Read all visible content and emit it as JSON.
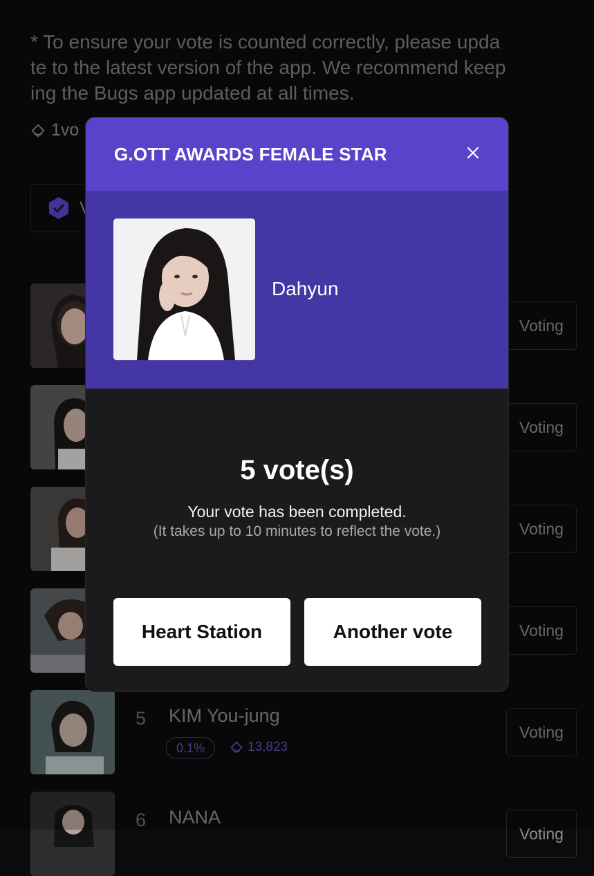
{
  "background": {
    "notice_top": "",
    "notice_lines": [
      "* To ensure your vote is counted correctly, please upda",
      "te to the latest version of the app. We recommend keep",
      "ing the Bugs app updated at all times."
    ],
    "vote_cost": "1vo",
    "verified_label": "V",
    "rows": [
      {
        "rank": "",
        "name": "",
        "pct": "",
        "count": "",
        "button": "Voting"
      },
      {
        "rank": "",
        "name": "",
        "pct": "",
        "count": "",
        "button": "Voting"
      },
      {
        "rank": "",
        "name": "",
        "pct": "",
        "count": "",
        "button": "Voting"
      },
      {
        "rank": "",
        "name": "",
        "pct": "",
        "count": "",
        "button": "Voting"
      },
      {
        "rank": "5",
        "name": "KIM You-jung",
        "pct": "0.1%",
        "count": "13,823",
        "button": "Voting"
      },
      {
        "rank": "6",
        "name": "NANA",
        "pct": "",
        "count": "",
        "button": "Voting"
      }
    ]
  },
  "modal": {
    "title": "G.OTT AWARDS FEMALE STAR",
    "candidate_name": "Dahyun",
    "votes": "5 vote(s)",
    "completed_message": "Your vote has been completed.",
    "reflect_message": "(It takes up to 10 minutes to reflect the vote.)",
    "buttons": {
      "heart_station": "Heart Station",
      "another_vote": "Another vote"
    }
  },
  "colors": {
    "header_purple": "#5a43cb",
    "panel_purple": "#4536a5",
    "modal_bg": "#1b1b1d",
    "page_bg": "#0b0b0c",
    "accent_badge": "#5c51b3"
  },
  "icons": {
    "close": "close-icon",
    "ticket": "ticket-icon",
    "verified": "verified-hexagon-icon"
  }
}
